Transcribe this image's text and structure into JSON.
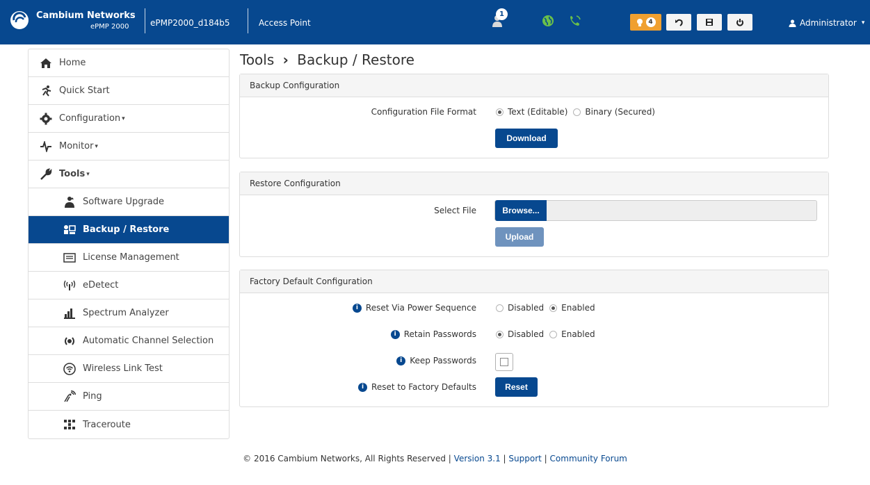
{
  "navbar": {
    "brand_name": "Cambium Networks",
    "brand_model": "ePMP 2000",
    "device_name": "ePMP2000_d184b5",
    "mode": "Access Point",
    "users_count": "1",
    "alerts_count": "4",
    "user_label": "Administrator",
    "icons": [
      "user-icon",
      "globe-icon",
      "phone-icon",
      "bulb-icon",
      "undo-icon",
      "save-icon",
      "power-icon",
      "user-icon"
    ]
  },
  "sidebar": {
    "items": [
      {
        "label": "Home",
        "icon": "home-icon"
      },
      {
        "label": "Quick Start",
        "icon": "running-man-icon"
      },
      {
        "label": "Configuration",
        "icon": "gear-icon"
      },
      {
        "label": "Monitor",
        "icon": "pulse-icon"
      },
      {
        "label": "Tools",
        "icon": "wrench-icon"
      },
      {
        "label": "Software Upgrade",
        "icon": "upgrade-icon"
      },
      {
        "label": "Backup / Restore",
        "icon": "backup-icon"
      },
      {
        "label": "License Management",
        "icon": "license-icon"
      },
      {
        "label": "eDetect",
        "icon": "antenna-icon"
      },
      {
        "label": "Spectrum Analyzer",
        "icon": "bar-chart-icon"
      },
      {
        "label": "Automatic Channel Selection",
        "icon": "channel-icon"
      },
      {
        "label": "Wireless Link Test",
        "icon": "wifi-icon"
      },
      {
        "label": "Ping",
        "icon": "ping-icon"
      },
      {
        "label": "Traceroute",
        "icon": "traceroute-icon"
      }
    ]
  },
  "page": {
    "title_section": "Tools",
    "title_separator": "›",
    "title_page": "Backup / Restore"
  },
  "backup": {
    "heading": "Backup Configuration",
    "format_label": "Configuration File Format",
    "option_text": "Text (Editable)",
    "option_binary": "Binary (Secured)",
    "selected": "Text (Editable)",
    "download_label": "Download"
  },
  "restore": {
    "heading": "Restore Configuration",
    "select_label": "Select File",
    "browse_label": "Browse...",
    "file_value": "",
    "upload_label": "Upload"
  },
  "factory": {
    "heading": "Factory Default Configuration",
    "reset_power_label": "Reset Via Power Sequence",
    "reset_power_selected": "Enabled",
    "retain_label": "Retain Passwords",
    "retain_selected": "Disabled",
    "keep_label": "Keep Passwords",
    "keep_checked": false,
    "reset_defaults_label": "Reset to Factory Defaults",
    "reset_button": "Reset",
    "disabled_label": "Disabled",
    "enabled_label": "Enabled"
  },
  "footer": {
    "copyright": "© 2016 Cambium Networks, All Rights Reserved",
    "sep": "|",
    "version": "Version 3.1",
    "support": "Support",
    "forum": "Community Forum"
  },
  "colors": {
    "primary": "#07488f",
    "alert": "#f0a030",
    "disabled_button": "#6f93be",
    "globe_green": "#6ac04a"
  }
}
